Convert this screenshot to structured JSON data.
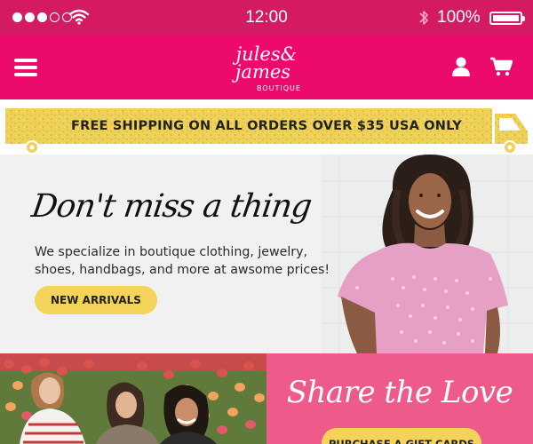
{
  "status_bar": {
    "time": "12:00",
    "battery": "100%",
    "battery_level": 1.0,
    "signal_bars_filled": 3,
    "signal_bars_total": 5
  },
  "header": {
    "logo_line1": "jules&",
    "logo_line2": "james",
    "logo_line3": "BOUTIQUE"
  },
  "shipping_banner": {
    "text": "FREE SHIPPING ON ALL ORDERS OVER $35 USA ONLY"
  },
  "hero": {
    "title": "Don't miss a thing",
    "description": "We specialize in boutique clothing, jewelry, shoes, handbags, and more at awsome prices!",
    "button_label": "NEW ARRIVALS"
  },
  "share_section": {
    "title": "Share the Love",
    "button_label": "PURCHASE A GIFT CARDS"
  },
  "colors": {
    "status_bar": "#d41a63",
    "header": "#ec0b6d",
    "banner_yellow": "#eed258",
    "button_yellow": "#f4d35a",
    "share_pink": "#ee5a8a"
  },
  "icons": [
    "signal-dots-icon",
    "wifi-icon",
    "bluetooth-icon",
    "battery-icon",
    "hamburger-menu-icon",
    "user-icon",
    "shopping-cart-icon",
    "truck-icon"
  ]
}
